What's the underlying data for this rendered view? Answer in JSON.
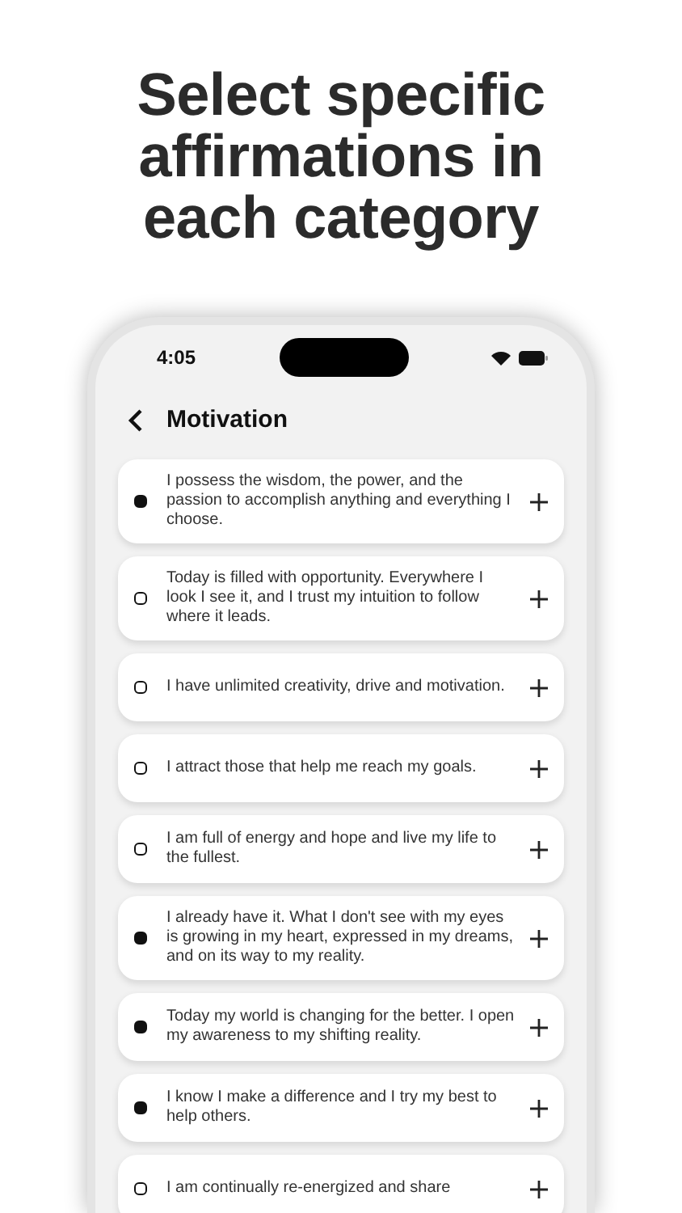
{
  "headline": "Select specific affirmations in each category",
  "status_bar": {
    "time": "4:05"
  },
  "header": {
    "title": "Motivation"
  },
  "affirmations": [
    {
      "text": "I possess the wisdom, the power, and the passion to accomplish anything and everything I choose.",
      "selected": true
    },
    {
      "text": "Today is filled with opportunity. Everywhere I look I see it, and I trust my intuition to follow where it leads.",
      "selected": false
    },
    {
      "text": "I have unlimited creativity, drive and motivation.",
      "selected": false
    },
    {
      "text": "I attract those that help me reach my goals.",
      "selected": false
    },
    {
      "text": "I am full of energy and hope and live my life to the fullest.",
      "selected": false
    },
    {
      "text": "I already have it. What I don't see with my eyes is growing in my heart, expressed in my dreams, and on its way to my reality.",
      "selected": true
    },
    {
      "text": "Today my world is changing for the better. I open my awareness to my shifting reality.",
      "selected": true
    },
    {
      "text": "I know I make a difference and I try my best to help others.",
      "selected": true
    },
    {
      "text": "I am continually re-energized and share",
      "selected": false
    }
  ]
}
